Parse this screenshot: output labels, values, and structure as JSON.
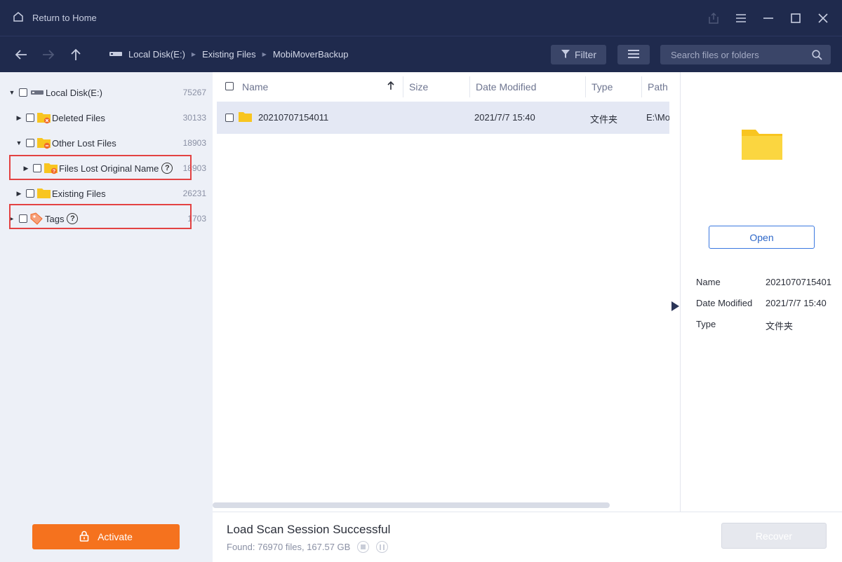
{
  "titlebar": {
    "home_label": "Return to Home"
  },
  "nav": {
    "breadcrumbs": [
      "Local Disk(E:)",
      "Existing Files",
      "MobiMoverBackup"
    ],
    "filter_label": "Filter",
    "search_placeholder": "Search files or folders"
  },
  "sidebar": {
    "items": [
      {
        "label": "Local Disk(E:)",
        "count": "75267",
        "icon": "drive-icon"
      },
      {
        "label": "Deleted Files",
        "count": "30133",
        "icon": "folder-deleted-icon"
      },
      {
        "label": "Other Lost Files",
        "count": "18903",
        "icon": "folder-lost-icon"
      },
      {
        "label": "Files Lost Original Name",
        "count": "18903",
        "icon": "folder-question-icon"
      },
      {
        "label": "Existing Files",
        "count": "26231",
        "icon": "folder-icon"
      },
      {
        "label": "Tags",
        "count": "1703",
        "icon": "tag-icon"
      }
    ],
    "activate_label": "Activate"
  },
  "list": {
    "columns": [
      "Name",
      "Size",
      "Date Modified",
      "Type",
      "Path"
    ],
    "rows": [
      {
        "name": "20210707154011",
        "size": "",
        "date": "2021/7/7 15:40",
        "type": "文件夹",
        "path": "E:\\Mo"
      }
    ]
  },
  "preview": {
    "open_label": "Open",
    "props": [
      {
        "key": "Name",
        "value": "2021070715401"
      },
      {
        "key": "Date Modified",
        "value": "2021/7/7 15:40"
      },
      {
        "key": "Type",
        "value": "文件夹"
      }
    ]
  },
  "status": {
    "title": "Load Scan Session Successful",
    "found": "Found: 76970 files, 167.57 GB",
    "recover_label": "Recover"
  },
  "colors": {
    "header_bg": "#1f2a4d",
    "sidebar_bg": "#edf0f7",
    "accent_orange": "#f5721e",
    "highlight_red": "#e34242",
    "selected_row": "#e4e8f4",
    "folder_yellow": "#f8c520"
  }
}
